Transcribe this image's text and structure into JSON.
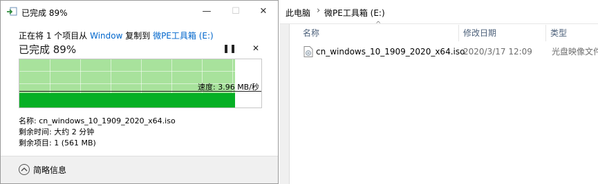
{
  "dialog": {
    "title": "已完成 89%",
    "status_prefix": "正在将 1 个项目从 ",
    "source": "Window",
    "status_middle": " 复制到 ",
    "destination": "微PE工具箱 (E:)",
    "progress_label": "已完成 89%",
    "progress_percent": 89,
    "speed_label": "速度: 3.96 MB/秒",
    "name_line": "名称: cn_windows_10_1909_2020_x64.iso",
    "time_line": "剩余时间: 大约 2 分钟",
    "items_line": "剩余项目: 1 (561 MB)",
    "details_label": "简略信息",
    "icons": {
      "title": "copy-icon",
      "minimize": "minimize-icon",
      "maximize": "maximize-icon",
      "close": "close-icon",
      "pause": "pause-icon",
      "cancel": "cancel-icon",
      "collapse": "chevron-up-icon"
    },
    "colors": {
      "progress_done": "#a8e29c",
      "progress_fill": "#06b025",
      "link": "#0066cc"
    }
  },
  "explorer": {
    "breadcrumb": [
      "此电脑",
      "微PE工具箱 (E:)"
    ],
    "columns": {
      "name": "名称",
      "date": "修改日期",
      "type": "类型"
    },
    "files": [
      {
        "name": "cn_windows_10_1909_2020_x64.iso",
        "date": "2020/3/17 12:09",
        "type": "光盘映像文件"
      }
    ]
  }
}
